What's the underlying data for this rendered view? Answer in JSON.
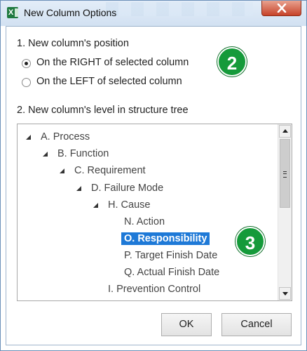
{
  "window": {
    "title": "New Column Options",
    "accent": "#1e79d7",
    "badge_color": "#159a3a"
  },
  "position_section": {
    "heading": "1. New column's position",
    "options": [
      {
        "label": "On the RIGHT of selected column",
        "checked": true
      },
      {
        "label": "On the LEFT of selected column",
        "checked": false
      }
    ]
  },
  "level_section": {
    "heading": "2. New column's level in structure tree",
    "tree": [
      {
        "label": "A. Process",
        "expanded": true
      },
      {
        "label": "B. Function",
        "expanded": true
      },
      {
        "label": "C. Requirement",
        "expanded": true
      },
      {
        "label": "D. Failure Mode",
        "expanded": true
      },
      {
        "label": "H. Cause",
        "expanded": true
      },
      {
        "label": "N. Action"
      },
      {
        "label": "O. Responsibility",
        "selected": true
      },
      {
        "label": "P. Target Finish Date"
      },
      {
        "label": "Q. Actual Finish Date"
      },
      {
        "label": "I. Prevention Control"
      }
    ]
  },
  "callouts": [
    "2",
    "3"
  ],
  "buttons": {
    "ok": "OK",
    "cancel": "Cancel"
  },
  "icons": {
    "app": "excel-icon",
    "close": "close-icon",
    "expand": "expanded-triangle-icon",
    "scroll_up": "arrow-up-icon",
    "scroll_down": "arrow-down-icon"
  }
}
